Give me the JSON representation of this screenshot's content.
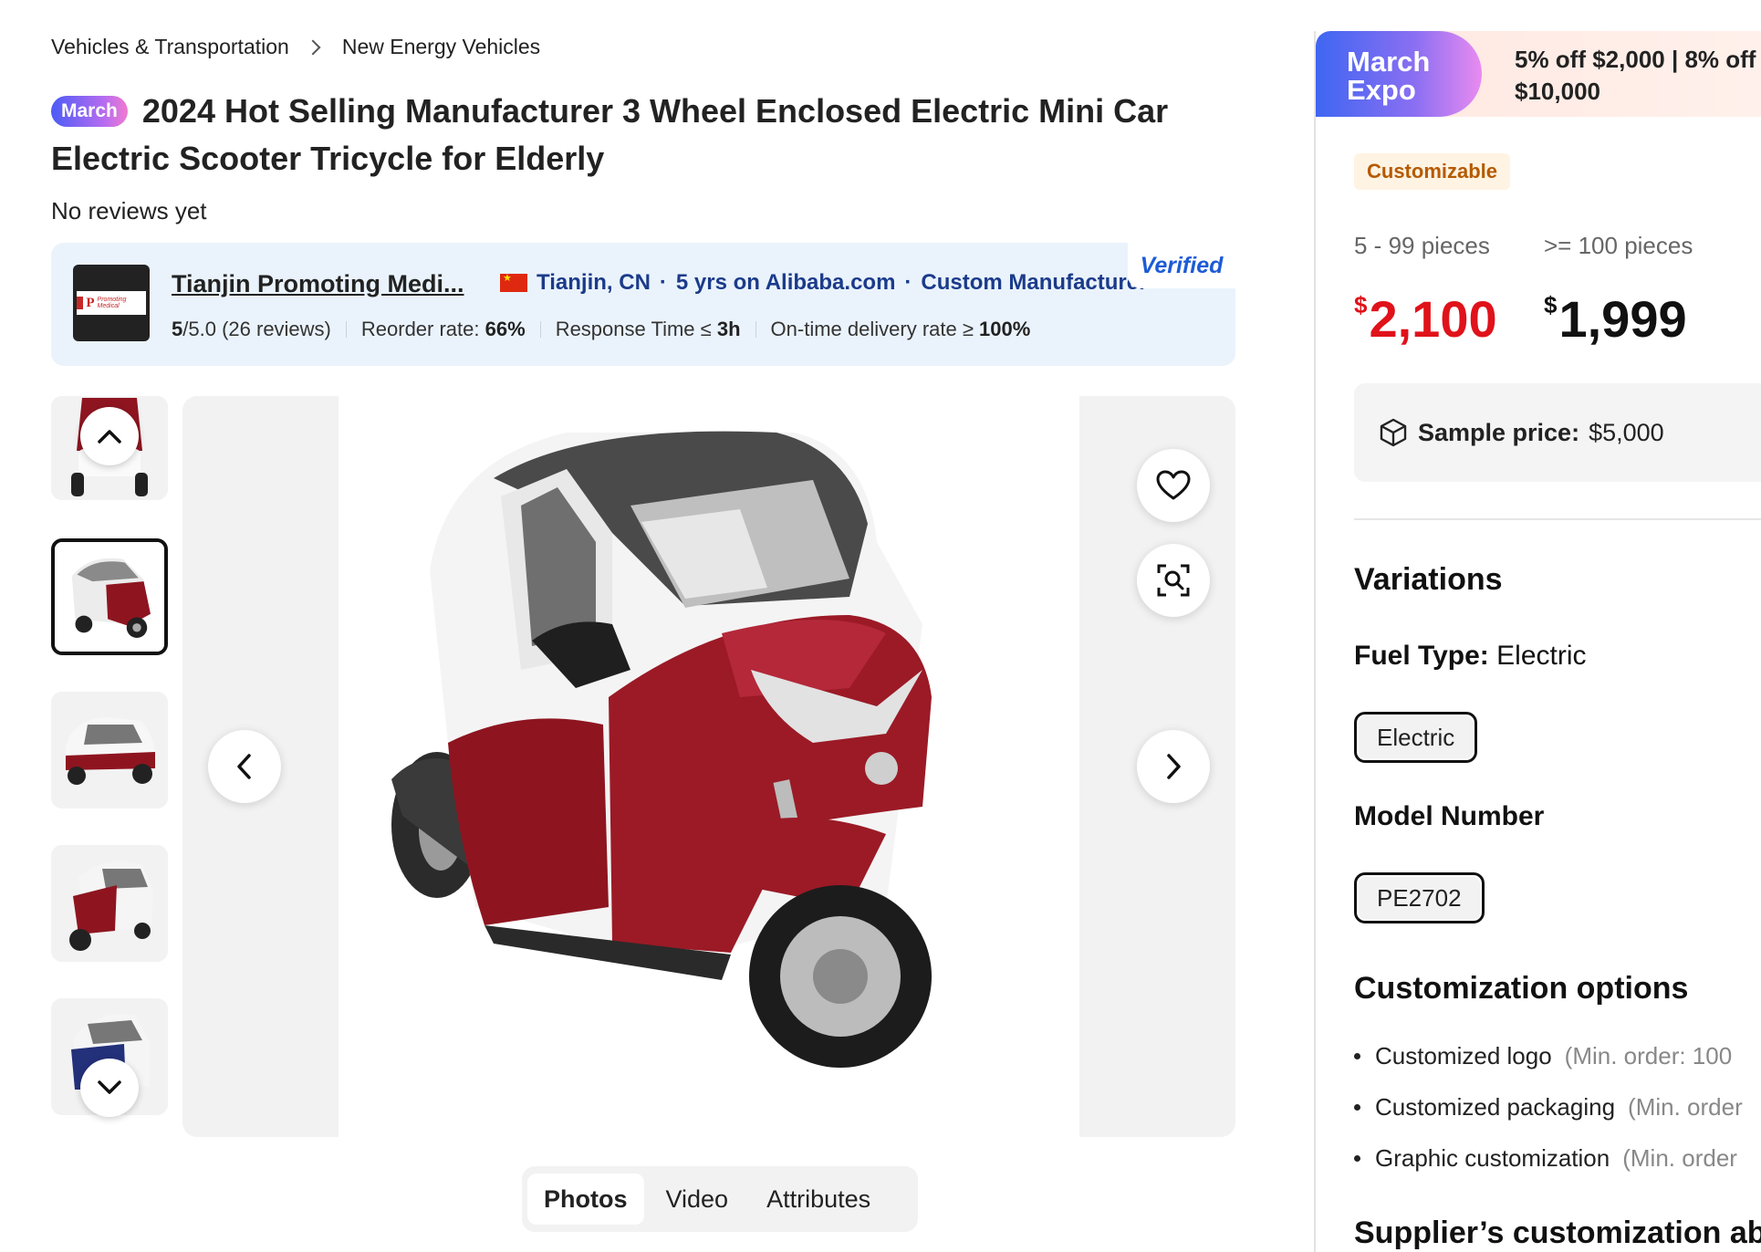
{
  "breadcrumb": {
    "items": [
      "Vehicles & Transportation",
      "New Energy Vehicles"
    ]
  },
  "product": {
    "expo_badge": "March",
    "title": "2024 Hot Selling Manufacturer 3 Wheel Enclosed Electric Mini Car Electric Scooter Tricycle for Elderly",
    "reviews": "No reviews yet"
  },
  "supplier": {
    "name": "Tianjin Promoting Medi...",
    "location": "Tianjin, CN",
    "years": "5 yrs on Alibaba.com",
    "type": "Custom Manufacturer",
    "verified": "Verified",
    "rating": "5",
    "rating_max": "/5.0",
    "review_count": "(26 reviews)",
    "reorder_label": "Reorder rate:",
    "reorder_value": "66%",
    "response_label": "Response Time ≤",
    "response_value": "3h",
    "ontime_label": "On-time delivery rate ≥",
    "ontime_value": "100%",
    "logo_text": "Promoting Medical"
  },
  "gallery": {
    "thumbnail_count": 5,
    "active_thumbnail": 2,
    "thumbnail_colors": [
      "red",
      "red",
      "red",
      "red",
      "blue"
    ]
  },
  "media_tabs": [
    "Photos",
    "Video",
    "Attributes"
  ],
  "panel": {
    "promo_logo_line1": "March",
    "promo_logo_line2": "Expo",
    "promo_line1": "5% off $2,000 | 8% off",
    "promo_line2": "$10,000",
    "customizable": "Customizable",
    "tiers": [
      {
        "label": "5 - 99 pieces",
        "currency": "$",
        "price": "2,100"
      },
      {
        "label": ">= 100 pieces",
        "currency": "$",
        "price": "1,999"
      }
    ],
    "sample_label": "Sample price:",
    "sample_value": "$5,000",
    "variations_title": "Variations",
    "fuel_label": "Fuel Type:",
    "fuel_value": "Electric",
    "fuel_chip": "Electric",
    "model_label": "Model Number",
    "model_chip": "PE2702",
    "custom_title": "Customization options",
    "custom_options": [
      {
        "name": "Customized logo",
        "note": "(Min. order: 100"
      },
      {
        "name": "Customized packaging",
        "note": "(Min. order"
      },
      {
        "name": "Graphic customization",
        "note": "(Min. order"
      }
    ],
    "supplier_custom_title": "Supplier’s customization ab"
  },
  "colors": {
    "price_red": "#e0121a",
    "verified_blue": "#1d5bd6",
    "supplier_bg": "#eaf3fc",
    "car_red": "#8e1520"
  },
  "icons": [
    "chevron-right-icon",
    "heart-icon",
    "image-search-icon",
    "chevron-left-icon",
    "chevron-up-icon",
    "chevron-down-icon",
    "box-icon",
    "china-flag-icon"
  ]
}
